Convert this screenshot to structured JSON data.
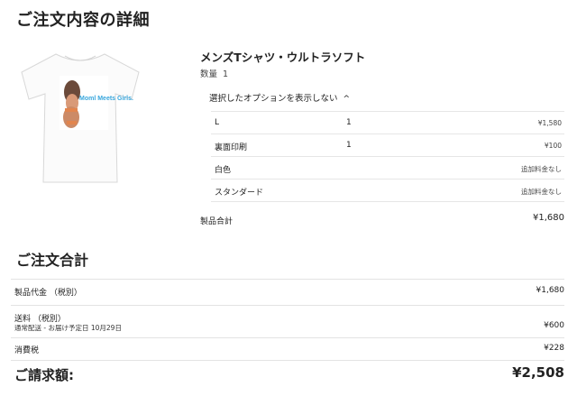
{
  "page": {
    "title": "ご注文内容の詳細"
  },
  "product": {
    "title": "メンズTシャツ・ウルトラソフト",
    "quantity_label": "数量",
    "quantity": "1",
    "print_text": "Moml Meets Girls.",
    "toggle_label": "選択したオプションを表示しない",
    "options": [
      {
        "name": "L",
        "qty": "1",
        "price": "¥1,580"
      },
      {
        "name": "裏面印刷",
        "qty": "1",
        "price": "¥100"
      },
      {
        "name": "白色",
        "qty": "",
        "price": "追加料金なし"
      },
      {
        "name": "スタンダード",
        "qty": "",
        "price": "追加料金なし"
      }
    ],
    "subtotal_label": "製品合計",
    "subtotal": "¥1,680"
  },
  "summary": {
    "title": "ご注文合計",
    "product_cost_label": "製品代金 （税別）",
    "product_cost": "¥1,680",
    "shipping_label": "送料 （税別）",
    "shipping_detail": "通常配送 - お届け予定日 10月29日",
    "shipping": "¥600",
    "tax_label": "消費税",
    "tax": "¥228",
    "total_label": "ご請求額:",
    "total": "¥2,508"
  }
}
